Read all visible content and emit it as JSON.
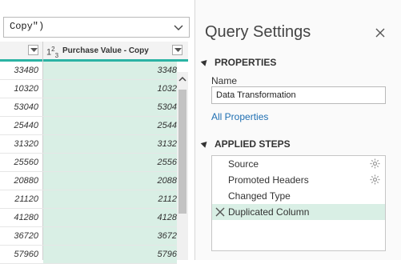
{
  "formula_bar": {
    "text_fragment": "Copy\")"
  },
  "grid": {
    "column_header": {
      "type_icon": "1²₃",
      "title": "Purchase Value - Copy"
    },
    "rows": [
      {
        "left": "33480",
        "right": "3348"
      },
      {
        "left": "10320",
        "right": "1032"
      },
      {
        "left": "53040",
        "right": "5304"
      },
      {
        "left": "25440",
        "right": "2544"
      },
      {
        "left": "31320",
        "right": "3132"
      },
      {
        "left": "25560",
        "right": "2556"
      },
      {
        "left": "20880",
        "right": "2088"
      },
      {
        "left": "21120",
        "right": "2112"
      },
      {
        "left": "41280",
        "right": "4128"
      },
      {
        "left": "36720",
        "right": "3672"
      },
      {
        "left": "57960",
        "right": "5796"
      }
    ]
  },
  "query_settings": {
    "title": "Query Settings",
    "properties_heading": "PROPERTIES",
    "name_label": "Name",
    "name_value": "Data Transformation",
    "all_properties_link": "All Properties",
    "applied_steps_heading": "APPLIED STEPS",
    "steps": [
      {
        "label": "Source",
        "has_gear": true
      },
      {
        "label": "Promoted Headers",
        "has_gear": true
      },
      {
        "label": "Changed Type",
        "has_gear": false
      },
      {
        "label": "Duplicated Column",
        "has_gear": false,
        "selected": true
      }
    ]
  },
  "colors": {
    "accent_teal": "#2bb3a4",
    "selected_green": "#d9efe5",
    "link_blue": "#1f6fb2"
  }
}
